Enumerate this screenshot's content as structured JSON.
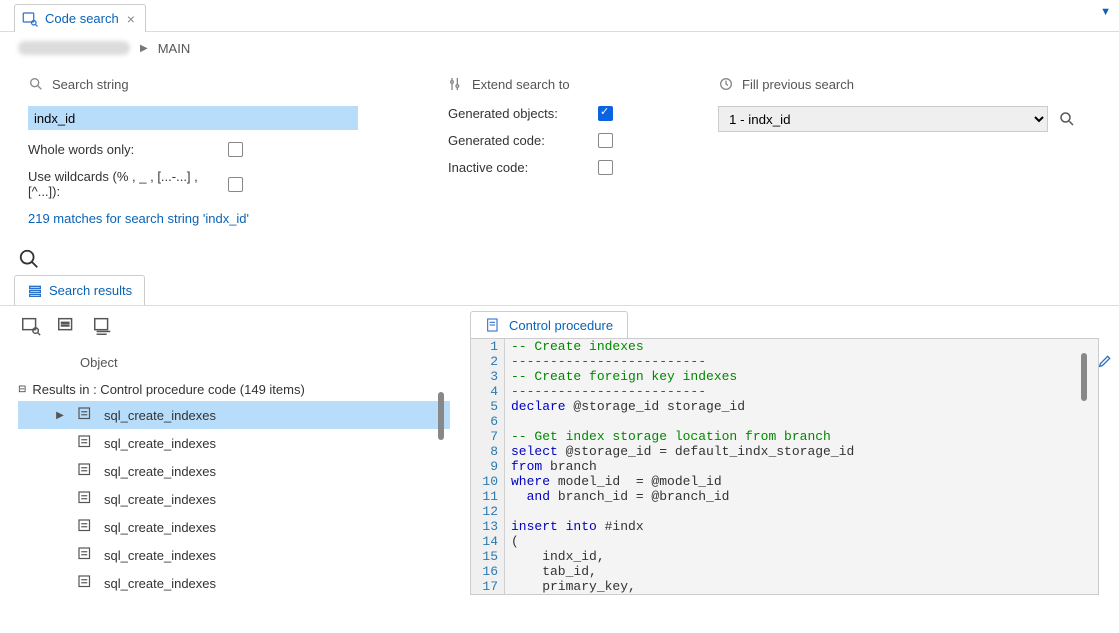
{
  "tab": {
    "title": "Code search"
  },
  "breadcrumb": {
    "main": "MAIN"
  },
  "searchString": {
    "heading": "Search string",
    "value": "indx_id",
    "wholeWordsLabel": "Whole words only:",
    "wildcardsLabel": "Use wildcards (% , _ , [...-...] , [^...]):",
    "matchText": "219 matches for search string 'indx_id'"
  },
  "extend": {
    "heading": "Extend search to",
    "generatedObjects": "Generated objects:",
    "generatedCode": "Generated code:",
    "inactiveCode": "Inactive code:"
  },
  "fillPrevious": {
    "heading": "Fill previous search",
    "option": "1 - indx_id"
  },
  "resultsTab": "Search results",
  "tree": {
    "headerObject": "Object",
    "groupLabel": "Results in : Control procedure code (149 items)",
    "items": [
      "sql_create_indexes",
      "sql_create_indexes",
      "sql_create_indexes",
      "sql_create_indexes",
      "sql_create_indexes",
      "sql_create_indexes",
      "sql_create_indexes"
    ]
  },
  "codeTab": "Control procedure",
  "code": [
    {
      "n": 1,
      "t": "-- Create indexes",
      "c": "cm"
    },
    {
      "n": 2,
      "t": "-------------------------",
      "c": "cm"
    },
    {
      "n": 3,
      "t": "-- Create foreign key indexes",
      "c": "cm"
    },
    {
      "n": 4,
      "t": "-------------------------",
      "c": "cm"
    },
    {
      "n": 5,
      "kw": "declare",
      "rest": " @storage_id storage_id"
    },
    {
      "n": 6,
      "t": ""
    },
    {
      "n": 7,
      "t": "-- Get index storage location from branch",
      "c": "cm"
    },
    {
      "n": 8,
      "kw": "select",
      "rest": " @storage_id = default_indx_storage_id"
    },
    {
      "n": 9,
      "kw": "from",
      "rest": " branch"
    },
    {
      "n": 10,
      "kw": "where",
      "rest": " model_id  = @model_id"
    },
    {
      "n": 11,
      "pre": "  ",
      "kw": "and",
      "rest": " branch_id = @branch_id"
    },
    {
      "n": 12,
      "t": ""
    },
    {
      "n": 13,
      "kw": "insert into",
      "rest": " #indx"
    },
    {
      "n": 14,
      "t": "("
    },
    {
      "n": 15,
      "t": "    indx_id,"
    },
    {
      "n": 16,
      "t": "    tab_id,"
    },
    {
      "n": 17,
      "t": "    primary_key,"
    }
  ]
}
